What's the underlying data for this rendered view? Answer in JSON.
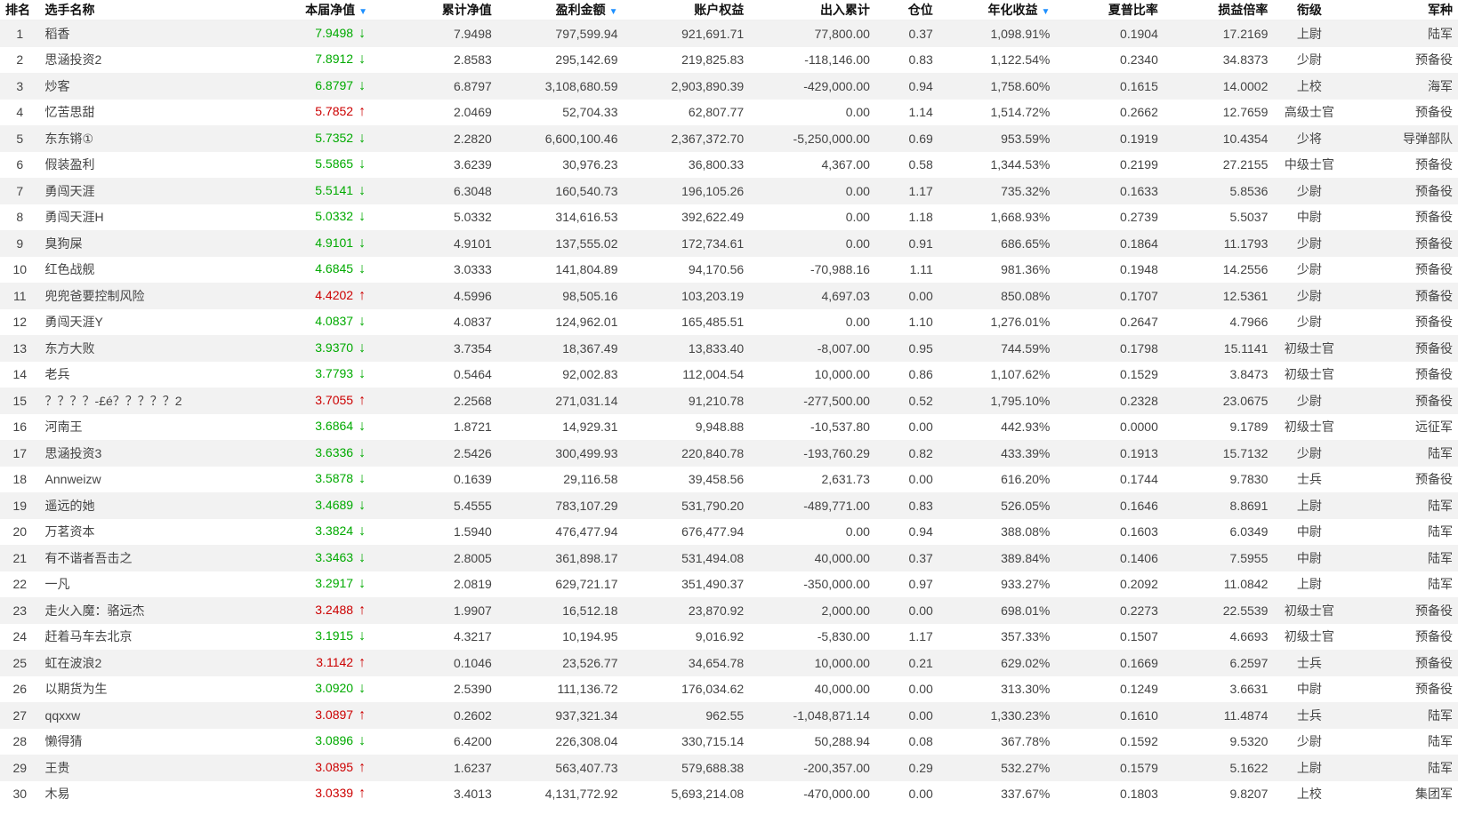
{
  "columns": {
    "rank": "排名",
    "name": "选手名称",
    "net_value": "本届净值",
    "cum_net_value": "累计净值",
    "profit": "盈利金额",
    "equity": "账户权益",
    "flow": "出入累计",
    "position": "仓位",
    "annual": "年化收益",
    "sharpe": "夏普比率",
    "pl_ratio": "损益倍率",
    "rank_title": "衔级",
    "branch": "军种"
  },
  "colors": {
    "up": "#cc0000",
    "down": "#00aa00",
    "sort": "#1e90ff"
  },
  "rows": [
    {
      "rank": "1",
      "name": "稻香",
      "nv": "7.9498",
      "dir": "down",
      "cum": "7.9498",
      "profit": "797,599.94",
      "equity": "921,691.71",
      "flow": "77,800.00",
      "pos": "0.37",
      "annual": "1,098.91%",
      "sharpe": "0.1904",
      "pl": "17.2169",
      "title": "上尉",
      "branch": "陆军"
    },
    {
      "rank": "2",
      "name": "思涵投资2",
      "nv": "7.8912",
      "dir": "down",
      "cum": "2.8583",
      "profit": "295,142.69",
      "equity": "219,825.83",
      "flow": "-118,146.00",
      "pos": "0.83",
      "annual": "1,122.54%",
      "sharpe": "0.2340",
      "pl": "34.8373",
      "title": "少尉",
      "branch": "预备役"
    },
    {
      "rank": "3",
      "name": "炒客",
      "nv": "6.8797",
      "dir": "down",
      "cum": "6.8797",
      "profit": "3,108,680.59",
      "equity": "2,903,890.39",
      "flow": "-429,000.00",
      "pos": "0.94",
      "annual": "1,758.60%",
      "sharpe": "0.1615",
      "pl": "14.0002",
      "title": "上校",
      "branch": "海军"
    },
    {
      "rank": "4",
      "name": "忆苦思甜",
      "nv": "5.7852",
      "dir": "up",
      "cum": "2.0469",
      "profit": "52,704.33",
      "equity": "62,807.77",
      "flow": "0.00",
      "pos": "1.14",
      "annual": "1,514.72%",
      "sharpe": "0.2662",
      "pl": "12.7659",
      "title": "高级士官",
      "branch": "预备役"
    },
    {
      "rank": "5",
      "name": "东东锵①",
      "nv": "5.7352",
      "dir": "down",
      "cum": "2.2820",
      "profit": "6,600,100.46",
      "equity": "2,367,372.70",
      "flow": "-5,250,000.00",
      "pos": "0.69",
      "annual": "953.59%",
      "sharpe": "0.1919",
      "pl": "10.4354",
      "title": "少将",
      "branch": "导弹部队"
    },
    {
      "rank": "6",
      "name": "假装盈利",
      "nv": "5.5865",
      "dir": "down",
      "cum": "3.6239",
      "profit": "30,976.23",
      "equity": "36,800.33",
      "flow": "4,367.00",
      "pos": "0.58",
      "annual": "1,344.53%",
      "sharpe": "0.2199",
      "pl": "27.2155",
      "title": "中级士官",
      "branch": "预备役"
    },
    {
      "rank": "7",
      "name": "勇闯天涯",
      "nv": "5.5141",
      "dir": "down",
      "cum": "6.3048",
      "profit": "160,540.73",
      "equity": "196,105.26",
      "flow": "0.00",
      "pos": "1.17",
      "annual": "735.32%",
      "sharpe": "0.1633",
      "pl": "5.8536",
      "title": "少尉",
      "branch": "预备役"
    },
    {
      "rank": "8",
      "name": "勇闯天涯H",
      "nv": "5.0332",
      "dir": "down",
      "cum": "5.0332",
      "profit": "314,616.53",
      "equity": "392,622.49",
      "flow": "0.00",
      "pos": "1.18",
      "annual": "1,668.93%",
      "sharpe": "0.2739",
      "pl": "5.5037",
      "title": "中尉",
      "branch": "预备役"
    },
    {
      "rank": "9",
      "name": "臭狗屎",
      "nv": "4.9101",
      "dir": "down",
      "cum": "4.9101",
      "profit": "137,555.02",
      "equity": "172,734.61",
      "flow": "0.00",
      "pos": "0.91",
      "annual": "686.65%",
      "sharpe": "0.1864",
      "pl": "11.1793",
      "title": "少尉",
      "branch": "预备役"
    },
    {
      "rank": "10",
      "name": "红色战舰",
      "nv": "4.6845",
      "dir": "down",
      "cum": "3.0333",
      "profit": "141,804.89",
      "equity": "94,170.56",
      "flow": "-70,988.16",
      "pos": "1.11",
      "annual": "981.36%",
      "sharpe": "0.1948",
      "pl": "14.2556",
      "title": "少尉",
      "branch": "预备役"
    },
    {
      "rank": "11",
      "name": "兜兜爸要控制风险",
      "nv": "4.4202",
      "dir": "up",
      "cum": "4.5996",
      "profit": "98,505.16",
      "equity": "103,203.19",
      "flow": "4,697.03",
      "pos": "0.00",
      "annual": "850.08%",
      "sharpe": "0.1707",
      "pl": "12.5361",
      "title": "少尉",
      "branch": "预备役"
    },
    {
      "rank": "12",
      "name": "勇闯天涯Y",
      "nv": "4.0837",
      "dir": "down",
      "cum": "4.0837",
      "profit": "124,962.01",
      "equity": "165,485.51",
      "flow": "0.00",
      "pos": "1.10",
      "annual": "1,276.01%",
      "sharpe": "0.2647",
      "pl": "4.7966",
      "title": "少尉",
      "branch": "预备役"
    },
    {
      "rank": "13",
      "name": "东方大败",
      "nv": "3.9370",
      "dir": "down",
      "cum": "3.7354",
      "profit": "18,367.49",
      "equity": "13,833.40",
      "flow": "-8,007.00",
      "pos": "0.95",
      "annual": "744.59%",
      "sharpe": "0.1798",
      "pl": "15.1141",
      "title": "初级士官",
      "branch": "预备役"
    },
    {
      "rank": "14",
      "name": "老兵",
      "nv": "3.7793",
      "dir": "down",
      "cum": "0.5464",
      "profit": "92,002.83",
      "equity": "112,004.54",
      "flow": "10,000.00",
      "pos": "0.86",
      "annual": "1,107.62%",
      "sharpe": "0.1529",
      "pl": "3.8473",
      "title": "初级士官",
      "branch": "预备役"
    },
    {
      "rank": "15",
      "name": "？？？？-£é？？？？？2",
      "nv": "3.7055",
      "dir": "up",
      "cum": "2.2568",
      "profit": "271,031.14",
      "equity": "91,210.78",
      "flow": "-277,500.00",
      "pos": "0.52",
      "annual": "1,795.10%",
      "sharpe": "0.2328",
      "pl": "23.0675",
      "title": "少尉",
      "branch": "预备役"
    },
    {
      "rank": "16",
      "name": "河南王",
      "nv": "3.6864",
      "dir": "down",
      "cum": "1.8721",
      "profit": "14,929.31",
      "equity": "9,948.88",
      "flow": "-10,537.80",
      "pos": "0.00",
      "annual": "442.93%",
      "sharpe": "0.0000",
      "pl": "9.1789",
      "title": "初级士官",
      "branch": "远征军"
    },
    {
      "rank": "17",
      "name": "思涵投资3",
      "nv": "3.6336",
      "dir": "down",
      "cum": "2.5426",
      "profit": "300,499.93",
      "equity": "220,840.78",
      "flow": "-193,760.29",
      "pos": "0.82",
      "annual": "433.39%",
      "sharpe": "0.1913",
      "pl": "15.7132",
      "title": "少尉",
      "branch": "陆军"
    },
    {
      "rank": "18",
      "name": "Annweizw",
      "nv": "3.5878",
      "dir": "down",
      "cum": "0.1639",
      "profit": "29,116.58",
      "equity": "39,458.56",
      "flow": "2,631.73",
      "pos": "0.00",
      "annual": "616.20%",
      "sharpe": "0.1744",
      "pl": "9.7830",
      "title": "士兵",
      "branch": "预备役"
    },
    {
      "rank": "19",
      "name": "遥远的她",
      "nv": "3.4689",
      "dir": "down",
      "cum": "5.4555",
      "profit": "783,107.29",
      "equity": "531,790.20",
      "flow": "-489,771.00",
      "pos": "0.83",
      "annual": "526.05%",
      "sharpe": "0.1646",
      "pl": "8.8691",
      "title": "上尉",
      "branch": "陆军"
    },
    {
      "rank": "20",
      "name": "万茗资本",
      "nv": "3.3824",
      "dir": "down",
      "cum": "1.5940",
      "profit": "476,477.94",
      "equity": "676,477.94",
      "flow": "0.00",
      "pos": "0.94",
      "annual": "388.08%",
      "sharpe": "0.1603",
      "pl": "6.0349",
      "title": "中尉",
      "branch": "陆军"
    },
    {
      "rank": "21",
      "name": "有不谐者吾击之",
      "nv": "3.3463",
      "dir": "down",
      "cum": "2.8005",
      "profit": "361,898.17",
      "equity": "531,494.08",
      "flow": "40,000.00",
      "pos": "0.37",
      "annual": "389.84%",
      "sharpe": "0.1406",
      "pl": "7.5955",
      "title": "中尉",
      "branch": "陆军"
    },
    {
      "rank": "22",
      "name": "一凡",
      "nv": "3.2917",
      "dir": "down",
      "cum": "2.0819",
      "profit": "629,721.17",
      "equity": "351,490.37",
      "flow": "-350,000.00",
      "pos": "0.97",
      "annual": "933.27%",
      "sharpe": "0.2092",
      "pl": "11.0842",
      "title": "上尉",
      "branch": "陆军"
    },
    {
      "rank": "23",
      "name": "走火入魔：骆远杰",
      "nv": "3.2488",
      "dir": "up",
      "cum": "1.9907",
      "profit": "16,512.18",
      "equity": "23,870.92",
      "flow": "2,000.00",
      "pos": "0.00",
      "annual": "698.01%",
      "sharpe": "0.2273",
      "pl": "22.5539",
      "title": "初级士官",
      "branch": "预备役"
    },
    {
      "rank": "24",
      "name": "赶着马车去北京",
      "nv": "3.1915",
      "dir": "down",
      "cum": "4.3217",
      "profit": "10,194.95",
      "equity": "9,016.92",
      "flow": "-5,830.00",
      "pos": "1.17",
      "annual": "357.33%",
      "sharpe": "0.1507",
      "pl": "4.6693",
      "title": "初级士官",
      "branch": "预备役"
    },
    {
      "rank": "25",
      "name": "虹在波浪2",
      "nv": "3.1142",
      "dir": "up",
      "cum": "0.1046",
      "profit": "23,526.77",
      "equity": "34,654.78",
      "flow": "10,000.00",
      "pos": "0.21",
      "annual": "629.02%",
      "sharpe": "0.1669",
      "pl": "6.2597",
      "title": "士兵",
      "branch": "预备役"
    },
    {
      "rank": "26",
      "name": "以期货为生",
      "nv": "3.0920",
      "dir": "down",
      "cum": "2.5390",
      "profit": "111,136.72",
      "equity": "176,034.62",
      "flow": "40,000.00",
      "pos": "0.00",
      "annual": "313.30%",
      "sharpe": "0.1249",
      "pl": "3.6631",
      "title": "中尉",
      "branch": "预备役"
    },
    {
      "rank": "27",
      "name": "qqxxw",
      "nv": "3.0897",
      "dir": "up",
      "cum": "0.2602",
      "profit": "937,321.34",
      "equity": "962.55",
      "flow": "-1,048,871.14",
      "pos": "0.00",
      "annual": "1,330.23%",
      "sharpe": "0.1610",
      "pl": "11.4874",
      "title": "士兵",
      "branch": "陆军"
    },
    {
      "rank": "28",
      "name": "懒得猜",
      "nv": "3.0896",
      "dir": "down",
      "cum": "6.4200",
      "profit": "226,308.04",
      "equity": "330,715.14",
      "flow": "50,288.94",
      "pos": "0.08",
      "annual": "367.78%",
      "sharpe": "0.1592",
      "pl": "9.5320",
      "title": "少尉",
      "branch": "陆军"
    },
    {
      "rank": "29",
      "name": "王贵",
      "nv": "3.0895",
      "dir": "up",
      "cum": "1.6237",
      "profit": "563,407.73",
      "equity": "579,688.38",
      "flow": "-200,357.00",
      "pos": "0.29",
      "annual": "532.27%",
      "sharpe": "0.1579",
      "pl": "5.1622",
      "title": "上尉",
      "branch": "陆军"
    },
    {
      "rank": "30",
      "name": "木易",
      "nv": "3.0339",
      "dir": "up",
      "cum": "3.4013",
      "profit": "4,131,772.92",
      "equity": "5,693,214.08",
      "flow": "-470,000.00",
      "pos": "0.00",
      "annual": "337.67%",
      "sharpe": "0.1803",
      "pl": "9.8207",
      "title": "上校",
      "branch": "集团军"
    }
  ]
}
